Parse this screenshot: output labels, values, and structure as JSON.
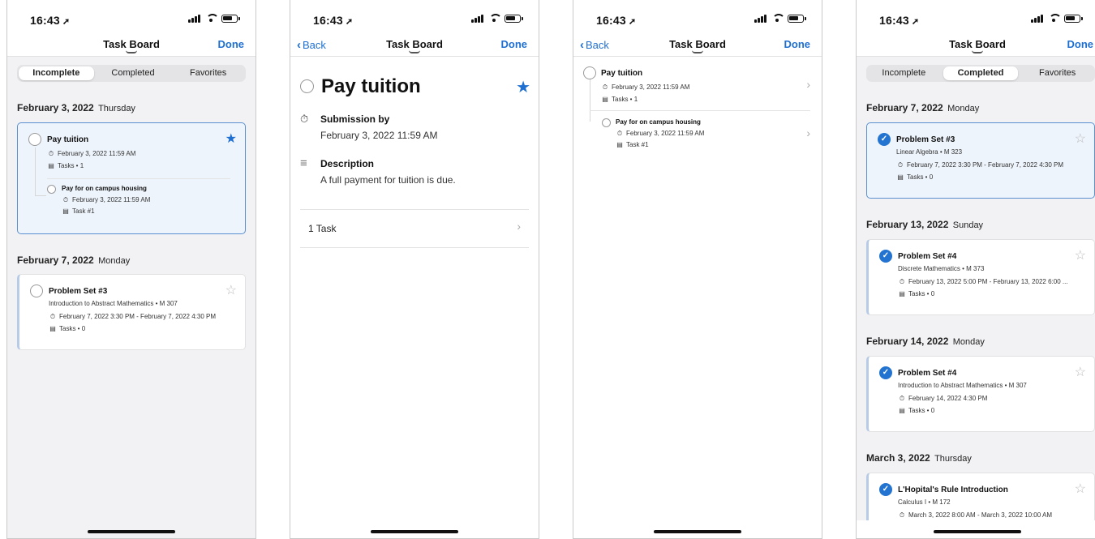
{
  "status": {
    "time": "16:43",
    "arrow": "➚"
  },
  "nav": {
    "title": "Task Board",
    "done": "Done",
    "back": "Back"
  },
  "tabs": [
    "Incomplete",
    "Completed",
    "Favorites"
  ],
  "screen1": {
    "date1": {
      "date": "February 3, 2022",
      "day": "Thursday"
    },
    "card1": {
      "title": "Pay tuition",
      "due": "February 3, 2022 11:59 AM",
      "tasks": "Tasks • 1",
      "sub": {
        "title": "Pay for on campus housing",
        "due": "February 3, 2022 11:59 AM",
        "task": "Task #1"
      }
    },
    "date2": {
      "date": "February 7, 2022",
      "day": "Monday"
    },
    "card2": {
      "title": "Problem Set #3",
      "course": "Introduction to Abstract Mathematics • M 307",
      "due": "February 7, 2022 3:30 PM - February 7, 2022 4:30 PM",
      "tasks": "Tasks • 0"
    }
  },
  "screen2": {
    "title": "Pay tuition",
    "submission_label": "Submission by",
    "submission_value": "February 3, 2022 11:59 AM",
    "description_label": "Description",
    "description_value": "A full payment for tuition is due.",
    "tasks_row": "1 Task"
  },
  "screen3": {
    "item1": {
      "title": "Pay tuition",
      "due": "February 3, 2022 11:59 AM",
      "tasks": "Tasks • 1"
    },
    "item2": {
      "title": "Pay for on campus housing",
      "due": "February 3, 2022 11:59 AM",
      "task": "Task #1"
    }
  },
  "screen4": {
    "groups": [
      {
        "date": "February 7, 2022",
        "day": "Monday",
        "title": "Problem Set #3",
        "course": "Linear Algebra • M 323",
        "due": "February 7, 2022 3:30 PM - February 7, 2022 4:30 PM",
        "tasks": "Tasks • 0"
      },
      {
        "date": "February 13, 2022",
        "day": "Sunday",
        "title": "Problem Set #4",
        "course": "Discrete Mathematics • M 373",
        "due": "February 13, 2022 5:00 PM - February 13, 2022 6:00 ...",
        "tasks": "Tasks • 0"
      },
      {
        "date": "February 14, 2022",
        "day": "Monday",
        "title": "Problem Set #4",
        "course": "Introduction to Abstract Mathematics • M 307",
        "due": "February 14, 2022 4:30 PM",
        "tasks": "Tasks • 0"
      },
      {
        "date": "March 3, 2022",
        "day": "Thursday",
        "title": "L'Hopital's Rule Introduction",
        "course": "Calculus I • M 172",
        "due": "March 3, 2022 8:00 AM - March 3, 2022 10:00 AM",
        "tasks": ""
      }
    ]
  },
  "icons": {
    "timer": "⏱",
    "clipboard": "▤",
    "description": "≡",
    "check": "✓",
    "star": "★",
    "star_outline": "☆",
    "chevron": "›"
  },
  "colors": {
    "accent": "#1f6fd1",
    "selected_bg": "#eef4fc",
    "selected_border": "#5a90cf"
  }
}
